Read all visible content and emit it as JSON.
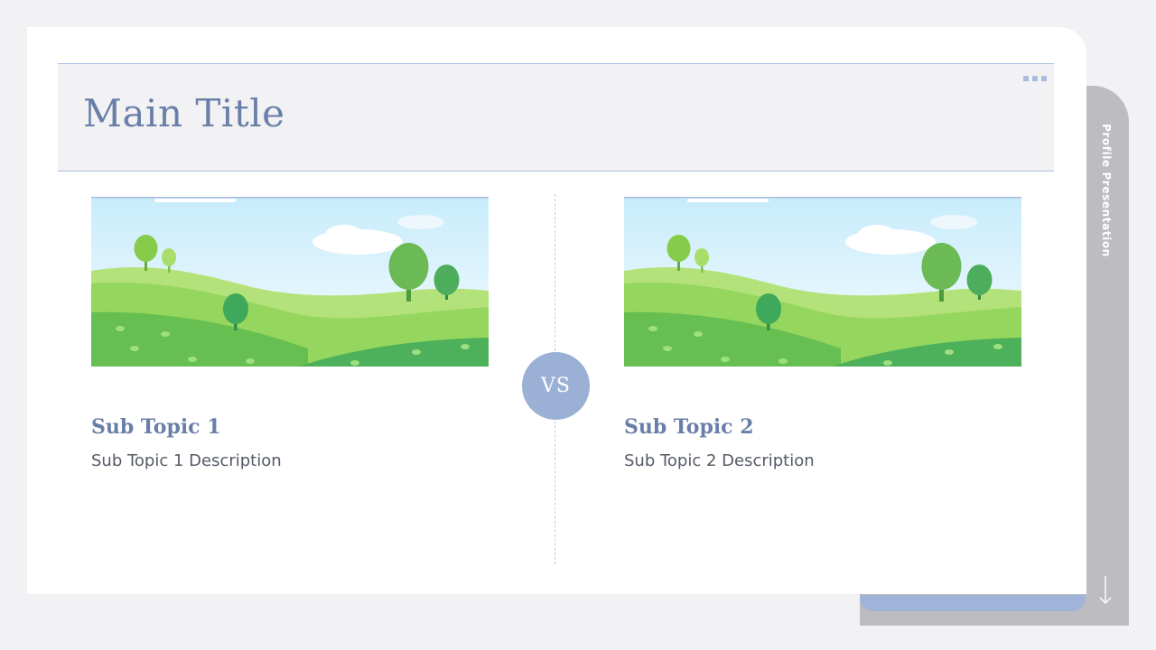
{
  "slide": {
    "title": "Main Title",
    "side_label": "Profile Presentation",
    "vs_label": "VS",
    "topics": [
      {
        "title": "Sub Topic 1",
        "description": "Sub Topic 1 Description"
      },
      {
        "title": "Sub Topic 2",
        "description": "Sub Topic 2 Description"
      }
    ]
  },
  "colors": {
    "accent": "#6a7fa8",
    "badge": "#9bb0d5",
    "band": "#f2f2f4",
    "side_tab": "#bdbcc0"
  },
  "icons": {
    "menu": "dots-icon",
    "scroll": "arrow-down-icon"
  }
}
